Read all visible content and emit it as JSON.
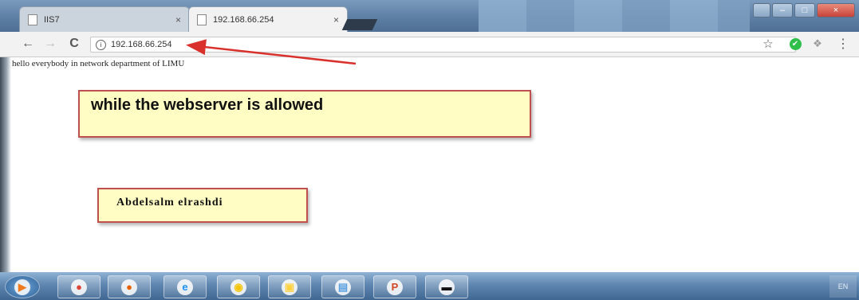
{
  "browser": {
    "tabs": [
      {
        "title": "IIS7",
        "close": "×"
      },
      {
        "title": "192.168.66.254",
        "close": "×"
      }
    ],
    "window_buttons": {
      "minimize": "–",
      "maximize": "□",
      "close": "×"
    },
    "address": "192.168.66.254",
    "nav": {
      "back": "←",
      "forward": "→",
      "reload": "C"
    },
    "right_icons": {
      "star": "☆",
      "extension": "✔",
      "extension2": "❖",
      "menu": "⋮"
    }
  },
  "page": {
    "text": "hello everybody in network department of LIMU"
  },
  "annotations": {
    "note1": "while the webserver is allowed",
    "note2": "Abdelsalm elrashdi",
    "arrow_color": "#d9302c",
    "note_fill": "#fffcc4",
    "note_border": "#c0504d"
  },
  "taskbar": {
    "apps": [
      {
        "name": "windows-media-player-icon",
        "glyph": "▶",
        "color": "#f07a20"
      },
      {
        "name": "chrome-icon",
        "glyph": "●",
        "color": "#db4437"
      },
      {
        "name": "firefox-icon",
        "glyph": "●",
        "color": "#e66000"
      },
      {
        "name": "internet-explorer-icon",
        "glyph": "e",
        "color": "#1e90ff"
      },
      {
        "name": "media-center-icon",
        "glyph": "◉",
        "color": "#f5c400"
      },
      {
        "name": "app-window-icon",
        "glyph": "▣",
        "color": "#ffd23f"
      },
      {
        "name": "network-monitor-icon",
        "glyph": "▤",
        "color": "#5aa0e0"
      },
      {
        "name": "powerpoint-icon",
        "glyph": "P",
        "color": "#d24726"
      },
      {
        "name": "command-prompt-icon",
        "glyph": "▬",
        "color": "#111111"
      }
    ],
    "tray_text": "EN"
  }
}
